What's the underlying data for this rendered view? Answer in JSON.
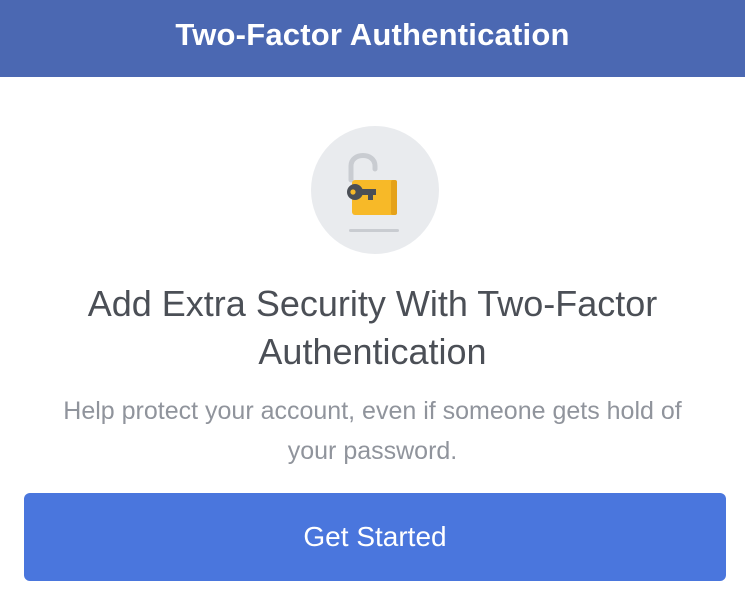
{
  "header": {
    "title": "Two-Factor Authentication"
  },
  "hero": {
    "icon": "unlocked-padlock-with-key-icon",
    "headline": "Add Extra Security With Two-Factor Authentication",
    "description": "Help protect your account, even if someone gets hold of your password."
  },
  "actions": {
    "primary_label": "Get Started"
  },
  "colors": {
    "header_bg": "#4b68b2",
    "button_bg": "#4a76dd",
    "headline_text": "#4b4f56",
    "description_text": "#90949c",
    "icon_circle_bg": "#e9ebee",
    "lock_body": "#f7b928",
    "key": "#4b4f56"
  }
}
